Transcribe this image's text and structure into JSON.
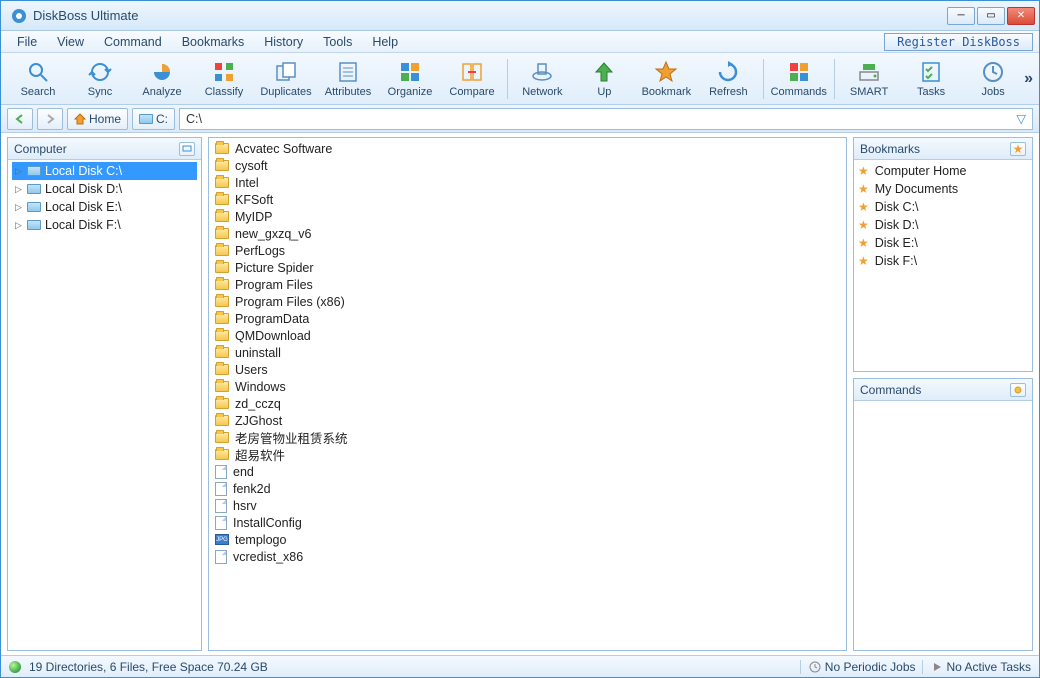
{
  "title": "DiskBoss Ultimate",
  "menu": [
    "File",
    "View",
    "Command",
    "Bookmarks",
    "History",
    "Tools",
    "Help"
  ],
  "register_label": "Register DiskBoss",
  "toolbar": [
    {
      "name": "search",
      "label": "Search",
      "color": "#3b8fd4"
    },
    {
      "name": "sync",
      "label": "Sync",
      "color": "#3b8fd4"
    },
    {
      "name": "analyze",
      "label": "Analyze",
      "color": "#3b8fd4"
    },
    {
      "name": "classify",
      "label": "Classify",
      "color": "#f0a030"
    },
    {
      "name": "duplicates",
      "label": "Duplicates",
      "color": "#5a8fc4"
    },
    {
      "name": "attributes",
      "label": "Attributes",
      "color": "#5a8fc4"
    },
    {
      "name": "organize",
      "label": "Organize",
      "color": "#3b8fd4"
    },
    {
      "name": "compare",
      "label": "Compare",
      "color": "#f0a030"
    }
  ],
  "toolbar2": [
    {
      "name": "network",
      "label": "Network",
      "color": "#5a8fc4"
    },
    {
      "name": "up",
      "label": "Up",
      "color": "#4caf50"
    },
    {
      "name": "bookmark",
      "label": "Bookmark",
      "color": "#f0a030"
    },
    {
      "name": "refresh",
      "label": "Refresh",
      "color": "#3b8fd4"
    }
  ],
  "toolbar3": [
    {
      "name": "commands",
      "label": "Commands",
      "color": "#f0a030"
    }
  ],
  "toolbar4": [
    {
      "name": "smart",
      "label": "SMART",
      "color": "#4caf50"
    },
    {
      "name": "tasks",
      "label": "Tasks",
      "color": "#3b8fd4"
    },
    {
      "name": "jobs",
      "label": "Jobs",
      "color": "#5a8fc4"
    }
  ],
  "nav": {
    "home_label": "Home",
    "drive_label": "C:",
    "path": "C:\\"
  },
  "left_panel": {
    "title": "Computer",
    "items": [
      {
        "label": "Local Disk C:\\",
        "selected": true
      },
      {
        "label": "Local Disk D:\\",
        "selected": false
      },
      {
        "label": "Local Disk E:\\",
        "selected": false
      },
      {
        "label": "Local Disk F:\\",
        "selected": false
      }
    ]
  },
  "files": [
    {
      "type": "folder",
      "name": "Acvatec Software"
    },
    {
      "type": "folder",
      "name": "cysoft"
    },
    {
      "type": "folder",
      "name": "Intel"
    },
    {
      "type": "folder",
      "name": "KFSoft"
    },
    {
      "type": "folder",
      "name": "MyIDP"
    },
    {
      "type": "folder",
      "name": "new_gxzq_v6"
    },
    {
      "type": "folder",
      "name": "PerfLogs"
    },
    {
      "type": "folder",
      "name": "Picture Spider"
    },
    {
      "type": "folder",
      "name": "Program Files"
    },
    {
      "type": "folder",
      "name": "Program Files (x86)"
    },
    {
      "type": "folder",
      "name": "ProgramData"
    },
    {
      "type": "folder",
      "name": "QMDownload"
    },
    {
      "type": "folder",
      "name": "uninstall"
    },
    {
      "type": "folder",
      "name": "Users"
    },
    {
      "type": "folder",
      "name": "Windows"
    },
    {
      "type": "folder",
      "name": "zd_cczq"
    },
    {
      "type": "folder",
      "name": "ZJGhost"
    },
    {
      "type": "folder",
      "name": "老房管物业租赁系统"
    },
    {
      "type": "folder",
      "name": "超易软件"
    },
    {
      "type": "file",
      "name": "end"
    },
    {
      "type": "file",
      "name": "fenk2d"
    },
    {
      "type": "file",
      "name": "hsrv"
    },
    {
      "type": "file",
      "name": "InstallConfig"
    },
    {
      "type": "jpg",
      "name": "templogo"
    },
    {
      "type": "file",
      "name": "vcredist_x86"
    }
  ],
  "bookmarks_panel": {
    "title": "Bookmarks",
    "items": [
      "Computer Home",
      "My Documents",
      "Disk C:\\",
      "Disk D:\\",
      "Disk E:\\",
      "Disk F:\\"
    ]
  },
  "commands_panel": {
    "title": "Commands"
  },
  "status": {
    "summary": "19 Directories, 6 Files, Free Space 70.24 GB",
    "periodic": "No Periodic Jobs",
    "tasks": "No Active Tasks"
  }
}
